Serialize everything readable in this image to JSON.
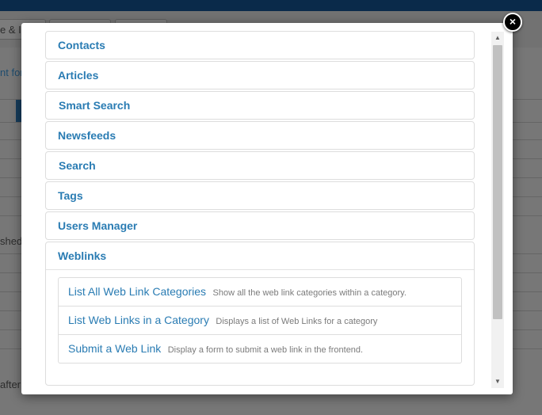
{
  "background": {
    "toolbar_button_text": "e & I",
    "link_text": "nt for",
    "row_text_1": "shed",
    "row_text_2": "after"
  },
  "modal": {
    "close_label": "×",
    "groups": [
      {
        "label": "Contacts"
      },
      {
        "label": "Articles"
      },
      {
        "label": "Smart Search"
      },
      {
        "label": "Newsfeeds"
      },
      {
        "label": "Search"
      },
      {
        "label": "Tags"
      },
      {
        "label": "Users Manager"
      },
      {
        "label": "Weblinks"
      }
    ],
    "weblinks_items": [
      {
        "title": "List All Web Link Categories",
        "desc": "Show all the web link categories within a category."
      },
      {
        "title": "List Web Links in a Category",
        "desc": "Displays a list of Web Links for a category"
      },
      {
        "title": "Submit a Web Link",
        "desc": "Display a form to submit a web link in the frontend."
      }
    ]
  }
}
